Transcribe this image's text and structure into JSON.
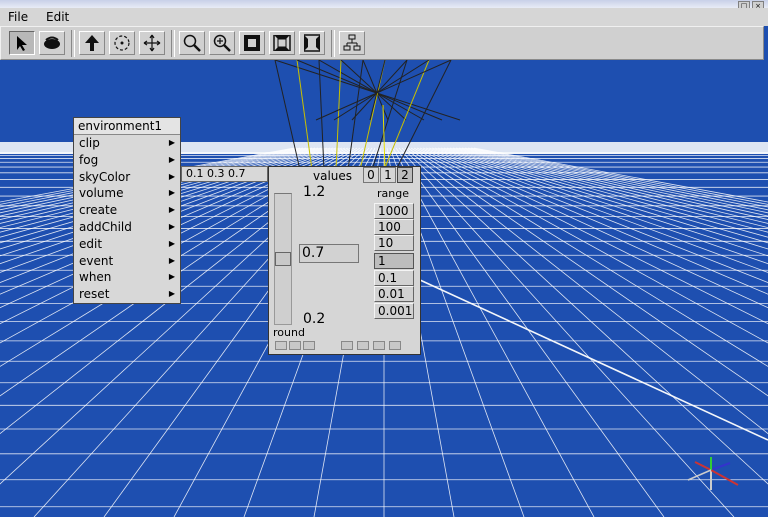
{
  "window": {
    "controls": [
      "□",
      "×"
    ]
  },
  "menubar": {
    "file": "File",
    "edit": "Edit"
  },
  "toolbar": {
    "buttons": [
      {
        "name": "select-arrow",
        "icon": "arrow-cursor-icon",
        "active": true
      },
      {
        "name": "object-view",
        "icon": "object-icon",
        "active": false
      },
      {
        "name": "walk",
        "icon": "walk-arrow-icon",
        "active": false
      },
      {
        "name": "rotate",
        "icon": "rotate-icon",
        "active": false
      },
      {
        "name": "move",
        "icon": "move-icon",
        "active": false
      },
      {
        "name": "zoom",
        "icon": "zoom-icon",
        "active": false
      },
      {
        "name": "zoom-in",
        "icon": "zoom-in-icon",
        "active": false
      },
      {
        "name": "front-view",
        "icon": "view-front-icon",
        "active": false
      },
      {
        "name": "top-view",
        "icon": "view-top-icon",
        "active": false
      },
      {
        "name": "side-view",
        "icon": "view-side-icon",
        "active": false
      },
      {
        "name": "scene-graph",
        "icon": "scene-graph-icon",
        "active": false
      }
    ]
  },
  "context_menu": {
    "title": "environment1",
    "items": [
      "clip",
      "fog",
      "skyColor",
      "volume",
      "create",
      "addChild",
      "edit",
      "event",
      "when",
      "reset"
    ]
  },
  "sky_color_value": "0.1 0.3 0.7",
  "values_panel": {
    "header": "values",
    "indices": [
      "0",
      "1",
      "2"
    ],
    "selected_index": "2",
    "max_label": "1.2",
    "current_value": "0.7",
    "min_label": "0.2",
    "slider_fraction": 0.5,
    "range_label": "range",
    "ranges": [
      "1000",
      "100",
      "10",
      "1",
      "0.1",
      "0.01",
      "0.001"
    ],
    "selected_range": "1",
    "round_label": "round"
  },
  "colors": {
    "sky": "#1e4fb0",
    "panel": "#d6d6d6",
    "grid": "#ffffff"
  }
}
